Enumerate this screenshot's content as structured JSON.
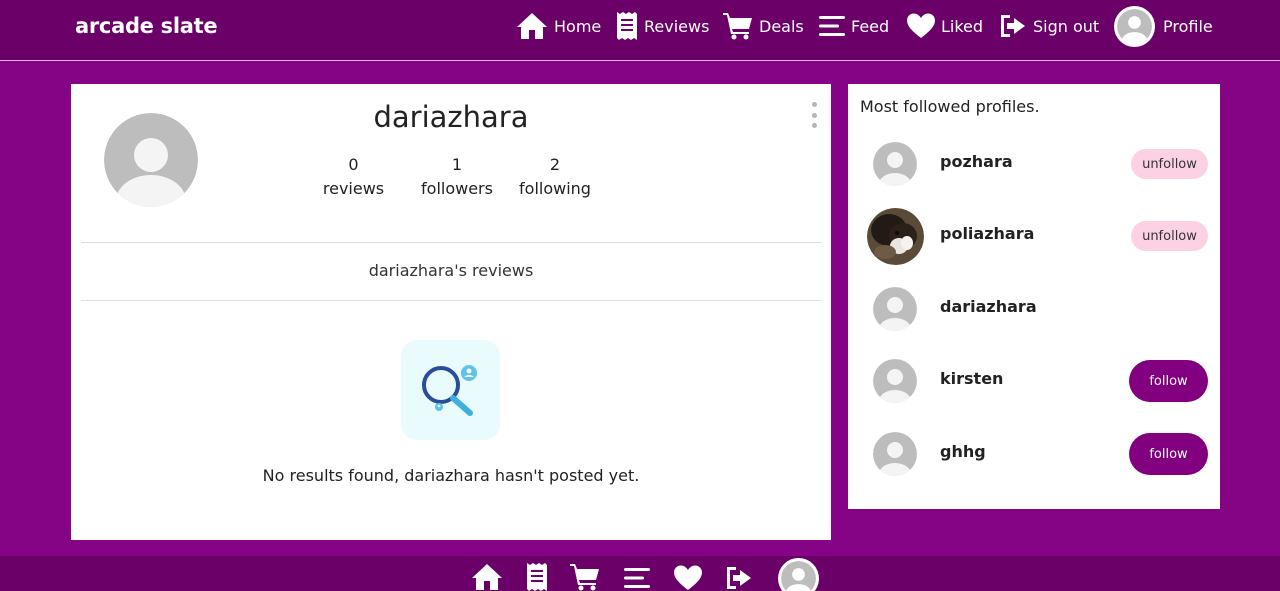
{
  "brand": "arcade slate",
  "nav": {
    "home": "Home",
    "reviews": "Reviews",
    "deals": "Deals",
    "feed": "Feed",
    "liked": "Liked",
    "sign_out": "Sign out",
    "profile": "Profile"
  },
  "profile": {
    "username": "dariazhara",
    "stats": [
      {
        "value": "0",
        "label": "reviews"
      },
      {
        "value": "1",
        "label": "followers"
      },
      {
        "value": "2",
        "label": "following"
      }
    ],
    "reviews_heading": "dariazhara's reviews",
    "empty_message": "No results found, dariazhara hasn't posted yet."
  },
  "sidebar": {
    "title": "Most followed profiles.",
    "profiles": [
      {
        "name": "pozhara",
        "action": "unfollow",
        "avatar": "default-avatar"
      },
      {
        "name": "poliazhara",
        "action": "unfollow",
        "avatar": "photo-avatar"
      },
      {
        "name": "dariazhara",
        "action": "",
        "avatar": "default-avatar"
      },
      {
        "name": "kirsten",
        "action": "follow",
        "avatar": "default-avatar"
      },
      {
        "name": "ghhg",
        "action": "follow",
        "avatar": "default-avatar"
      }
    ]
  },
  "colors": {
    "background": "#850385",
    "navbar": "#6a0068",
    "follow_button": "#82007f",
    "unfollow_button": "#fcd1e4"
  }
}
